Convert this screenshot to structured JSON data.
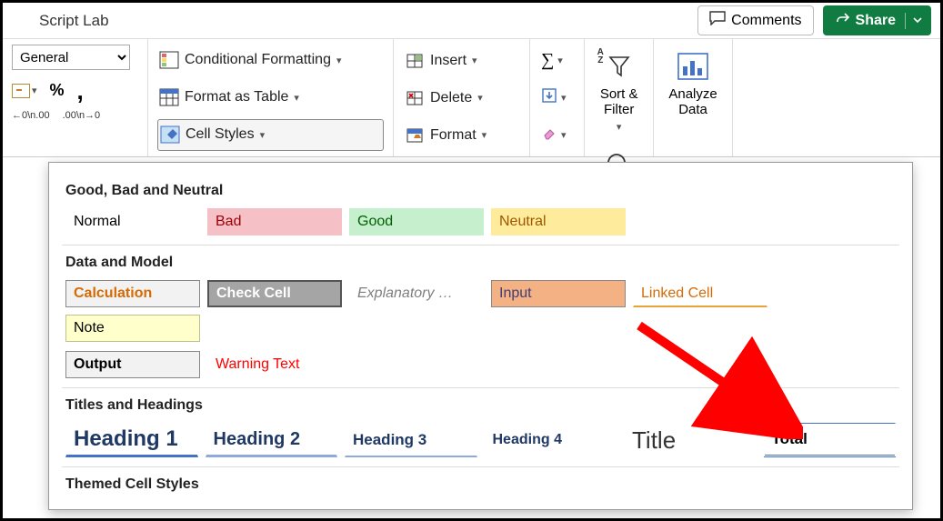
{
  "titlebar": {
    "tab": "Script Lab",
    "comments": "Comments",
    "share": "Share"
  },
  "ribbon": {
    "number": {
      "format_selected": "General",
      "percent": "%",
      "comma": ",",
      "inc_dec": "←.0\n.00",
      "dec_dec": ".00\n→.0"
    },
    "styles": {
      "cond_fmt": "Conditional Formatting",
      "format_table": "Format as Table",
      "cell_styles": "Cell Styles"
    },
    "cells": {
      "insert": "Insert",
      "delete": "Delete",
      "format": "Format"
    },
    "editing": {
      "sort_filter": "Sort &\nFilter",
      "find_select": "Find &\nSelect"
    },
    "analyze": "Analyze\nData"
  },
  "dropdown": {
    "sec1": "Good, Bad and Neutral",
    "normal": "Normal",
    "bad": "Bad",
    "good": "Good",
    "neutral": "Neutral",
    "sec2": "Data and Model",
    "calculation": "Calculation",
    "check_cell": "Check Cell",
    "explanatory": "Explanatory …",
    "input": "Input",
    "linked_cell": "Linked Cell",
    "note": "Note",
    "output": "Output",
    "warning": "Warning Text",
    "sec3": "Titles and Headings",
    "h1": "Heading 1",
    "h2": "Heading 2",
    "h3": "Heading 3",
    "h4": "Heading 4",
    "title": "Title",
    "total": "Total",
    "sec4": "Themed Cell Styles"
  }
}
